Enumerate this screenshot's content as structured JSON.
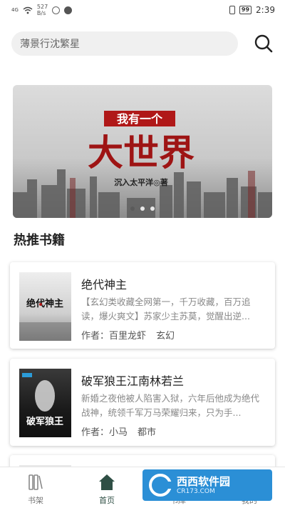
{
  "statusbar": {
    "network": "4G",
    "speed_value": "527",
    "speed_unit": "B/s",
    "battery": "99",
    "time": "2:39"
  },
  "search": {
    "value": "薄景行沈繁星"
  },
  "banner": {
    "slide_count": 3,
    "active_index": 0,
    "tag": "我有一个",
    "title": "大世界",
    "author_line": "沉入太平洋◎著"
  },
  "section": {
    "title": "热推书籍"
  },
  "books": [
    {
      "title": "绝代神主",
      "description": "【玄幻类收藏全网第一，千万收藏，百万追读，爆火爽文】苏家少主苏莫，觉醒出逆...",
      "author_label": "作者：",
      "author": "百里龙虾",
      "category": "玄幻",
      "cover_text": "绝代神主"
    },
    {
      "title": "破军狼王江南林若兰",
      "description": "新婚之夜他被人陷害入狱，六年后他成为绝代战神，统领千军万马荣耀归来，只为手...",
      "author_label": "作者：",
      "author": "小马",
      "category": "都市",
      "cover_text": "破军狼王"
    }
  ],
  "nav": {
    "items": [
      {
        "label": "书架",
        "icon": "bookshelf-icon"
      },
      {
        "label": "首页",
        "icon": "home-icon"
      },
      {
        "label": "书库",
        "icon": "library-icon"
      },
      {
        "label": "我的",
        "icon": "profile-icon"
      }
    ],
    "active": "首页"
  },
  "watermark": {
    "name": "西西软件园",
    "url": "CR173.COM"
  },
  "colors": {
    "active_nav": "#2f4f45",
    "search_bg": "#f0f0f0",
    "banner_red": "#b01818",
    "watermark_bg": "#2b8fd6"
  }
}
